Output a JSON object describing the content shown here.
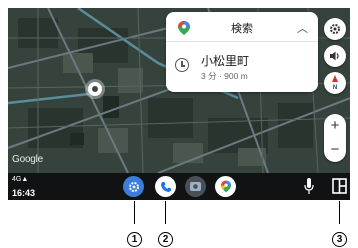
{
  "map": {
    "attribution": "Google"
  },
  "navigation_card": {
    "search_label": "検索",
    "collapse_icon": "chevron-up-icon",
    "destination": {
      "name": "小松里町",
      "eta": "3 分 · 900 m"
    }
  },
  "map_controls": {
    "settings_icon": "gear-icon",
    "sound_icon": "speaker-icon",
    "compass_label": "N",
    "zoom_in": "+",
    "zoom_out": "−"
  },
  "status_bar": {
    "signal": "4G▲",
    "time": "16:43"
  },
  "app_bar": {
    "apps": [
      "settings",
      "phone",
      "media",
      "maps"
    ],
    "voice_icon": "microphone-icon",
    "dashboard_icon": "grid-icon"
  },
  "callouts": [
    "1",
    "2",
    "3"
  ],
  "colors": {
    "accent_blue": "#3b7ddd",
    "bar_background": "#101213",
    "card_background": "#ffffff"
  }
}
